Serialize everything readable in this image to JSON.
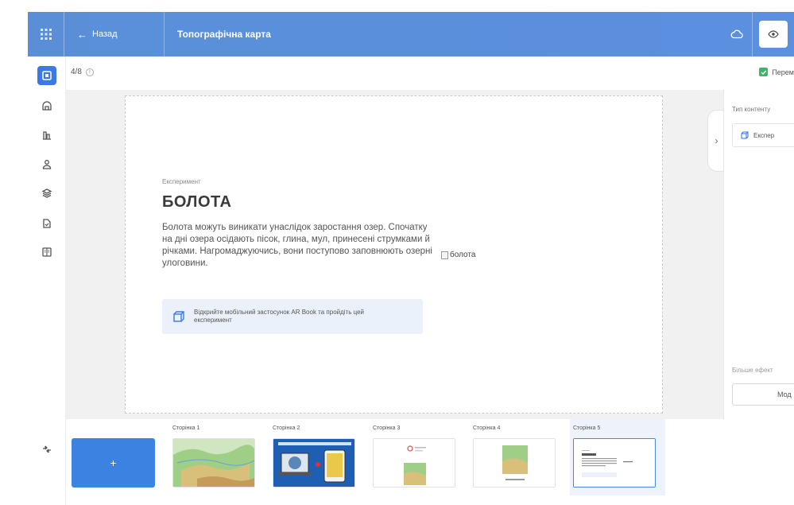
{
  "topbar": {
    "back_label": "Назад",
    "title": "Топографічна карта"
  },
  "subheader": {
    "page_counter": "4/8",
    "preview_label": "Перем"
  },
  "slide": {
    "type_label": "Експеримент",
    "title": "БОЛОТА",
    "body": "Болота можуть виникати унаслідок заростання озер. Спочатку на дні озера осідають пісок, глина, мул, принесені струмками й річками. Нагромаджуючись, вони поступово заповнюють озерні улоговини.",
    "image_alt": "болота",
    "ar_banner_text": "Відкрийте мобільний застосунок AR Book та пройдіть цей експеримент"
  },
  "right_panel": {
    "content_type_label": "Тип контенту",
    "content_type_value": "Експер",
    "effects_label": "Більше ефект",
    "button_label": "Мод"
  },
  "filmstrip": {
    "add_label": "+",
    "pages": [
      {
        "label": "Сторінка 1"
      },
      {
        "label": "Сторінка 2"
      },
      {
        "label": "Сторінка 3"
      },
      {
        "label": "Сторінка 4"
      },
      {
        "label": "Сторінка 5"
      }
    ]
  },
  "colors": {
    "topbar": "#5a8fd8",
    "accent": "#3c79e5",
    "check": "#3fb56a"
  },
  "icons": {
    "rail": [
      "slide-icon",
      "home-icon",
      "chart-icon",
      "users-icon",
      "layers-icon",
      "document-icon",
      "book-icon",
      "plugin-icon"
    ]
  }
}
